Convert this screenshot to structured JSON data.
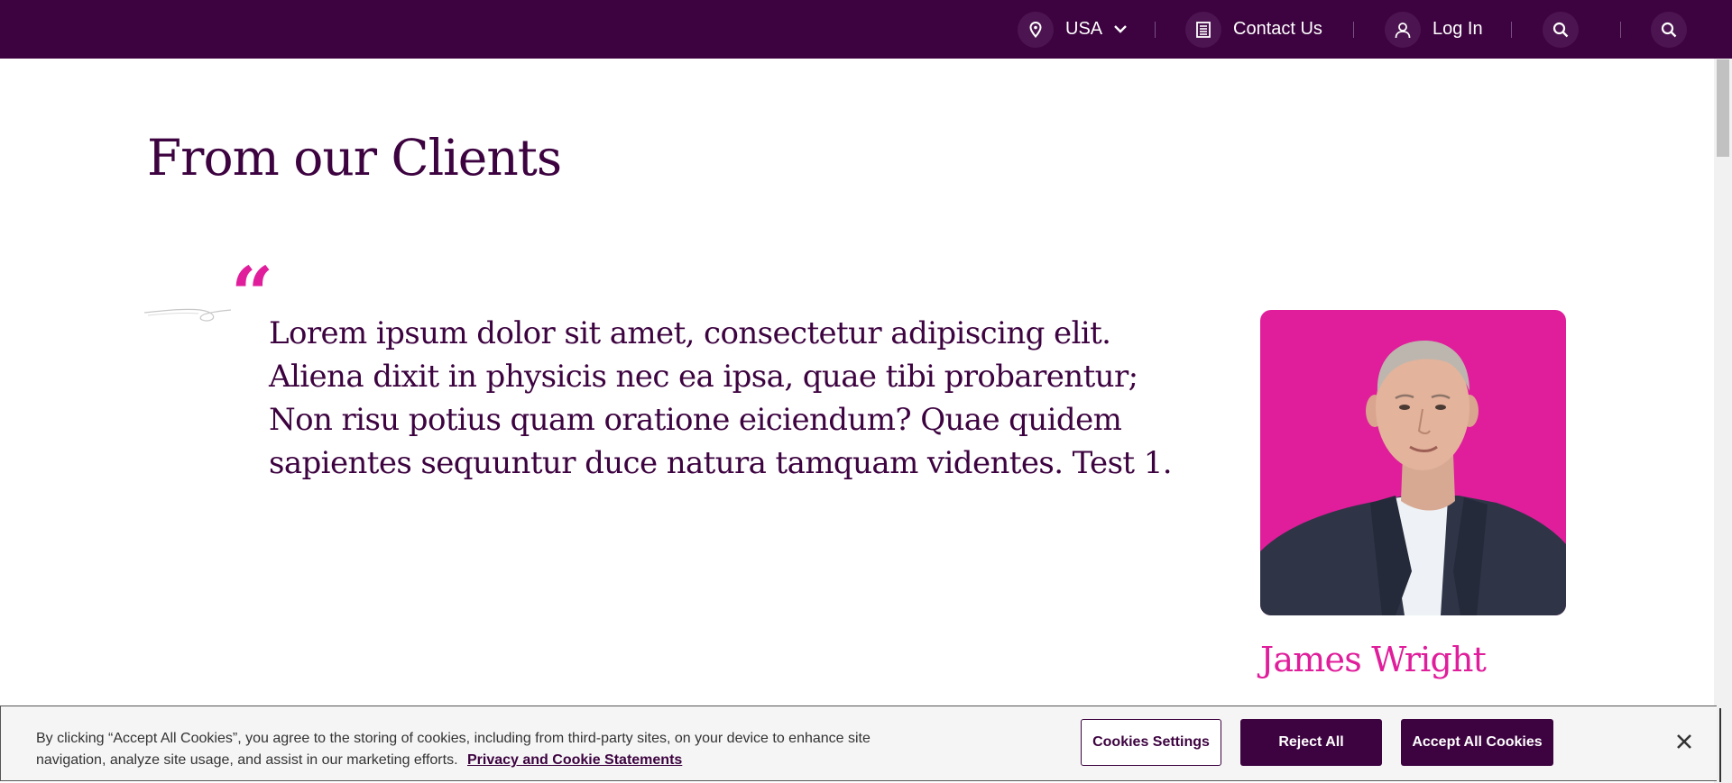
{
  "header": {
    "region_label": "USA",
    "contact_label": "Contact Us",
    "login_label": "Log In"
  },
  "section": {
    "title": "From our Clients"
  },
  "testimonial": {
    "quote_mark": "“",
    "text": "Lorem ipsum dolor sit amet, consectetur adipiscing elit. Aliena dixit in physicis nec ea ipsa, quae tibi probarentur; Non risu potius quam oratione eiciendum? Quae quidem sapientes sequuntur duce natura tamquam videntes. Test 1.",
    "client_name": "James Wright"
  },
  "cookie_banner": {
    "message": "By clicking “Accept All Cookies”, you agree to the storing of cookies, including from third-party sites, on your device to enhance site navigation, analyze site usage, and assist in our marketing efforts.",
    "privacy_link": "Privacy and Cookie Statements",
    "settings_label": "Cookies Settings",
    "reject_label": "Reject All",
    "accept_label": "Accept All Cookies"
  },
  "colors": {
    "brand_purple": "#3d0340",
    "accent_magenta": "#e01d9b"
  },
  "icons": {
    "location": "location-pin-icon",
    "chevron": "chevron-down-icon",
    "contact": "document-list-icon",
    "user": "user-icon",
    "search": "search-icon",
    "close": "close-icon"
  }
}
